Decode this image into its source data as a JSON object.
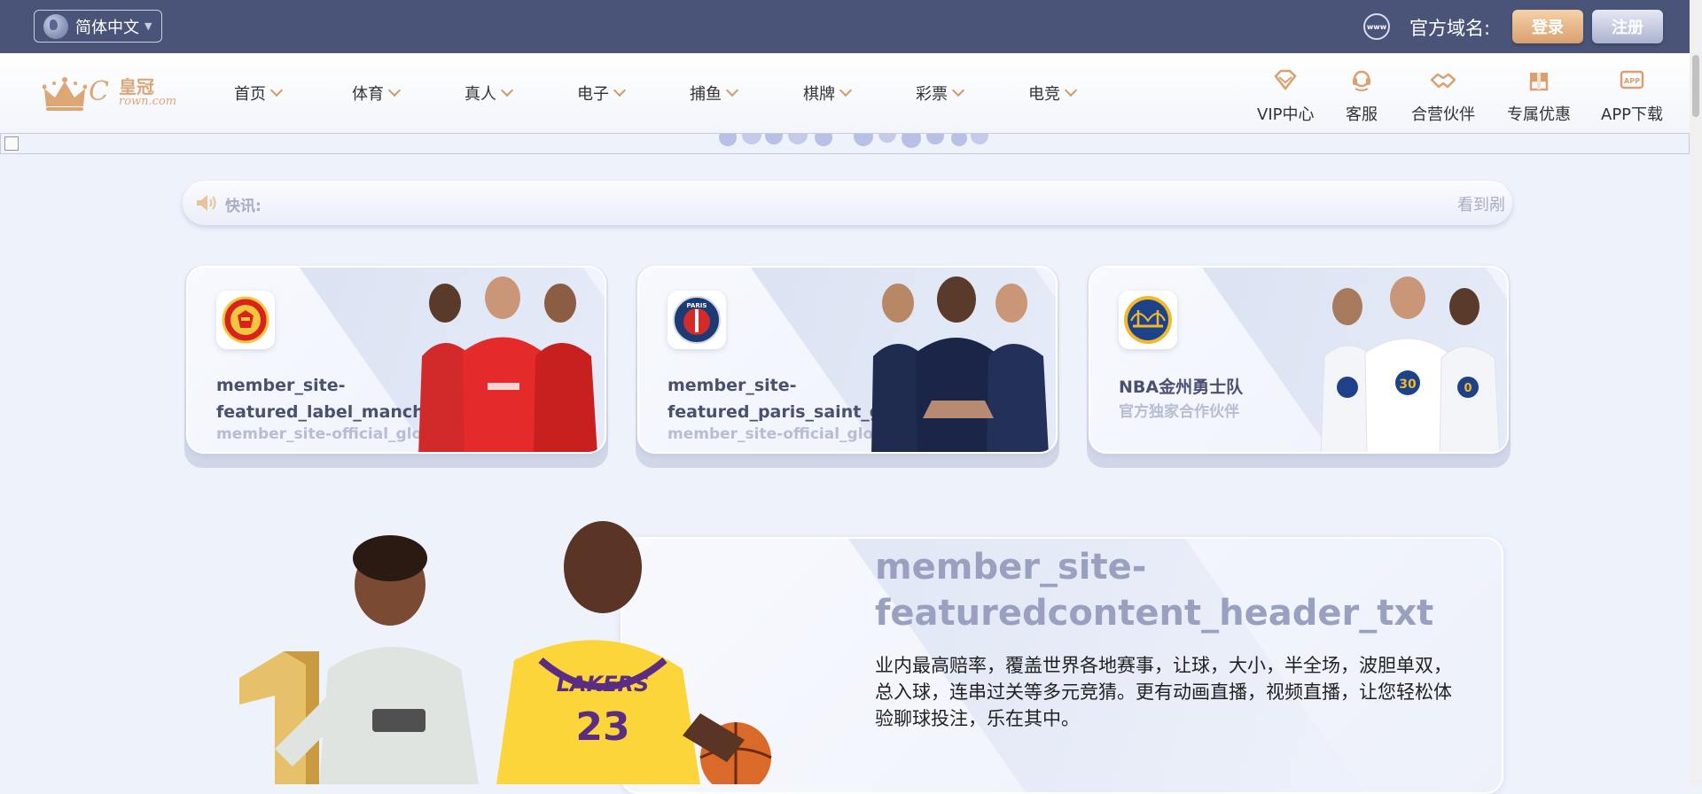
{
  "topbar": {
    "language": "简体中文",
    "domain_label": "官方域名:",
    "www_icon_text": "www",
    "login_label": "登录",
    "register_label": "注册"
  },
  "logo": {
    "cn": "皇冠",
    "en_big": "C",
    "en_small": "rown.com"
  },
  "nav": {
    "items": [
      "首页",
      "体育",
      "真人",
      "电子",
      "捕鱼",
      "棋牌",
      "彩票",
      "电竞"
    ],
    "utils": [
      "VIP中心",
      "客服",
      "合营伙伴",
      "专属优惠",
      "APP下载"
    ]
  },
  "ticker": {
    "label": "快讯:",
    "text": "看到剐"
  },
  "cards": [
    {
      "title": "member_site-featured_label_manchester",
      "subtitle": "member_site-official_global_partner",
      "badge_icon": "manchester-united-crest"
    },
    {
      "title": "member_site-featured_paris_saint_germain",
      "subtitle": "member_site-official_global_partner",
      "badge_icon": "psg-crest"
    },
    {
      "title": "NBA金州勇士队",
      "subtitle": "官方独家合作伙伴",
      "badge_icon": "golden-state-warriors-logo"
    }
  ],
  "feature": {
    "title": "member_site-featuredcontent_header_txt",
    "description": "业内最高赔率，覆盖世界各地赛事，让球，大小，半全场，波胆单双，总入球，连串过关等多元竞猜。更有动画直播，视频直播，让您轻松体验聊球投注，乐在其中。"
  },
  "colors": {
    "topbar": "#4a5378",
    "accent": "#d9a070",
    "page_bg": "#eef2fb"
  }
}
